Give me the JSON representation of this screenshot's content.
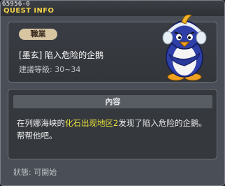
{
  "window": {
    "quest_id": "65956-0",
    "title": "QUEST INFO"
  },
  "info": {
    "job_badge": "職業",
    "quest_name": "[墨玄] 陷入危险的企鹅",
    "level_text": "建議等級: 30~34"
  },
  "content": {
    "header": "內容",
    "desc_part1": "在列娜海峡的",
    "desc_highlight": "化石出现地区2",
    "desc_part2": "发现了陷入危险的企鹅。帮帮他吧。"
  },
  "status": "狀態: 可開始",
  "colors": {
    "title": "#f3d24a",
    "highlight": "#e9e33a",
    "badge": "#d8c6a3"
  },
  "icons": {
    "close": "close-icon",
    "npc": "penguin-npc-icon"
  }
}
